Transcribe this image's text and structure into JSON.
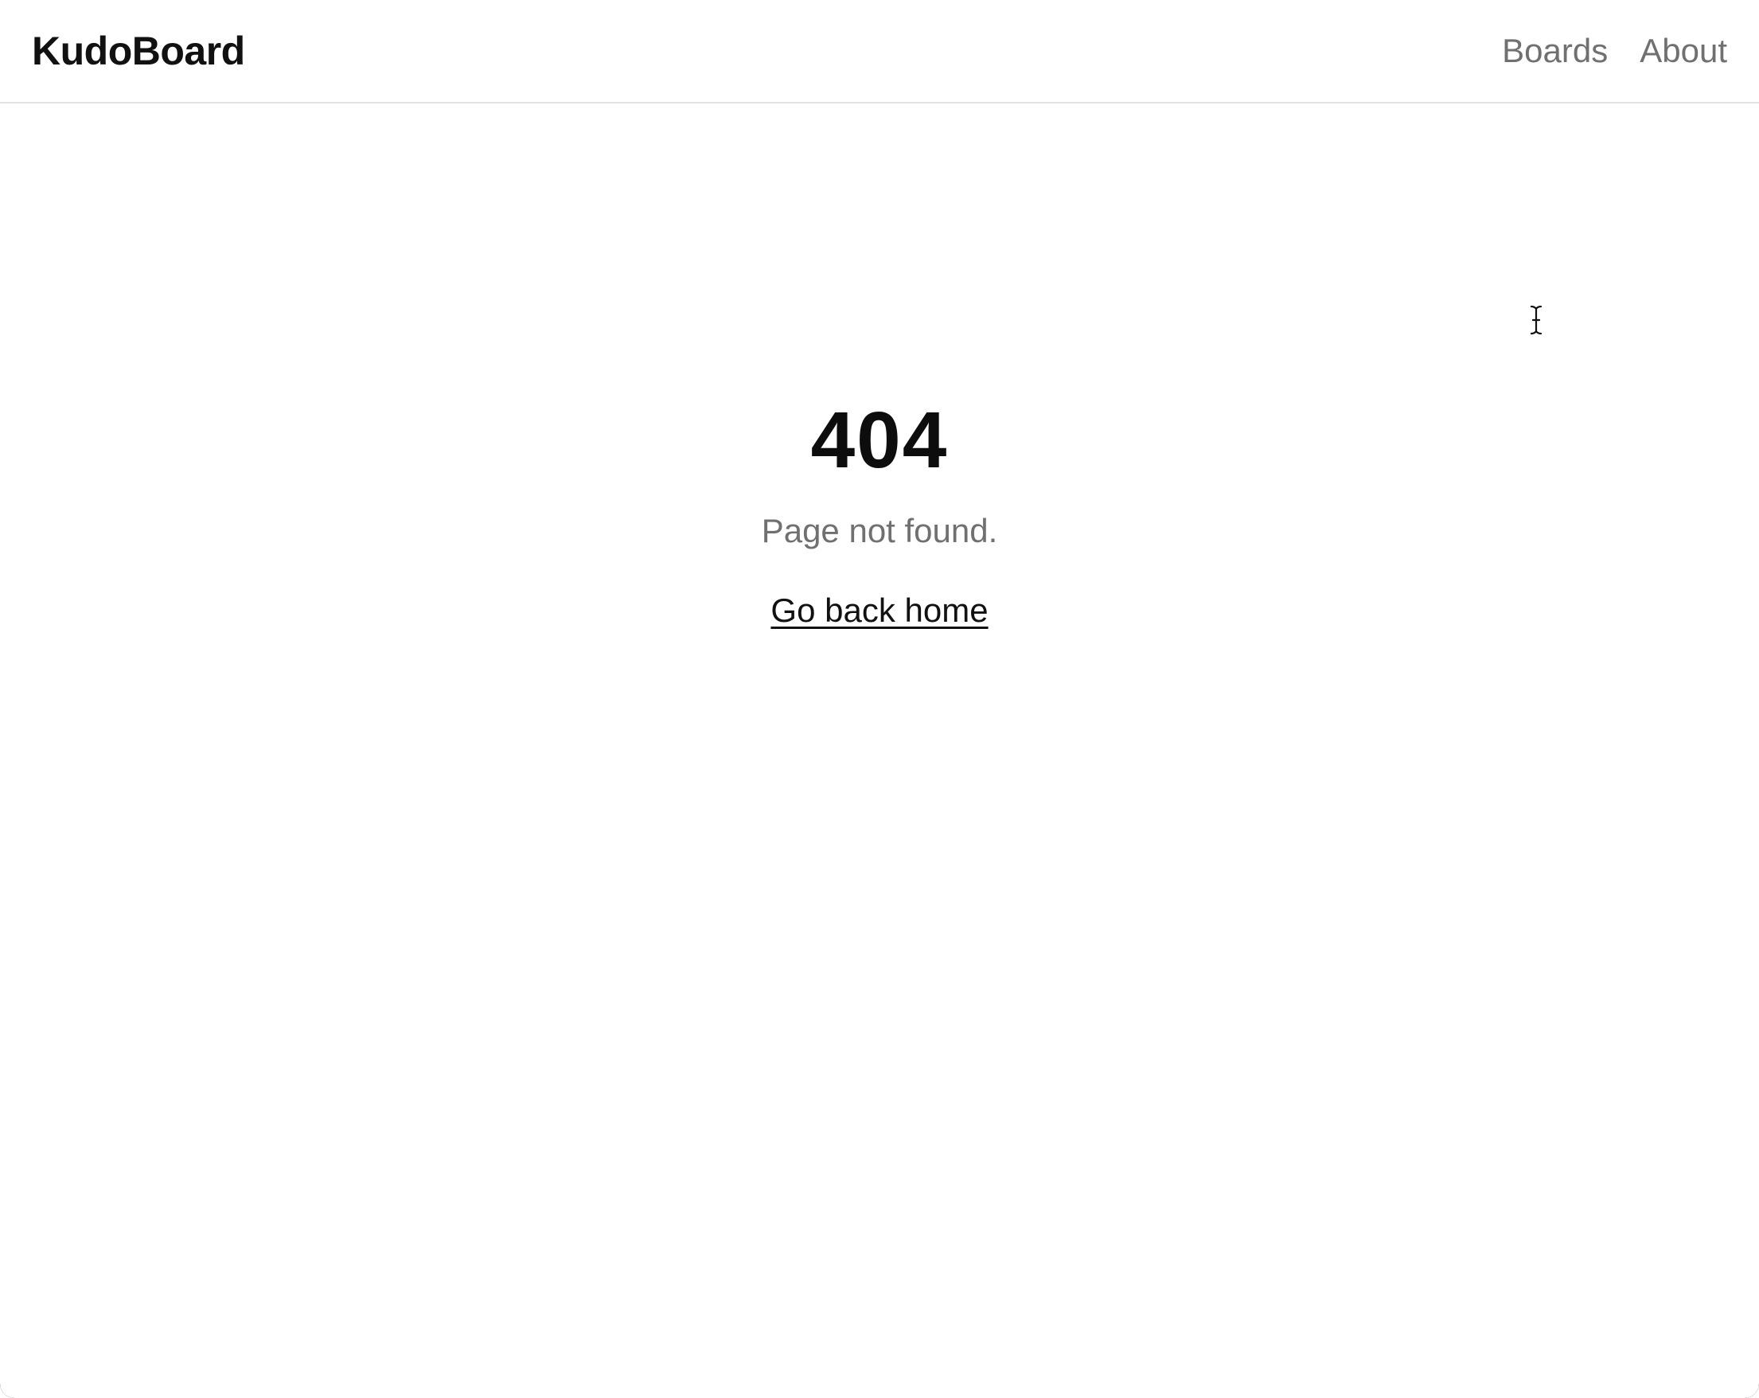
{
  "header": {
    "brand": "KudoBoard",
    "nav": [
      {
        "label": "Boards"
      },
      {
        "label": "About"
      }
    ]
  },
  "error": {
    "code": "404",
    "message": "Page not found.",
    "home_link": "Go back home"
  },
  "cursor": {
    "type": "text-cursor-icon"
  }
}
